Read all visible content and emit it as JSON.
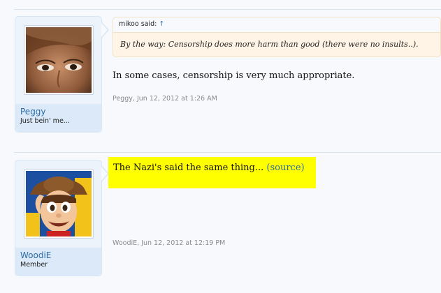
{
  "posts": [
    {
      "username": "Peggy",
      "usertitle": "Just bein' me...",
      "quote": {
        "author_line": "mikoo said: ",
        "up_arrow": "↑",
        "text": "By the way: Censorship does more harm than good (there were no insults..)."
      },
      "message": "In some cases, censorship is very much appropriate.",
      "meta": "Peggy, Jun 12, 2012 at 1:26 AM"
    },
    {
      "username": "WoodiE",
      "usertitle": "Member",
      "message": "The Nazi's said the same thing... ",
      "source_link": "(source)",
      "meta": "WoodiE, Jun 12, 2012 at 12:19 PM"
    }
  ]
}
